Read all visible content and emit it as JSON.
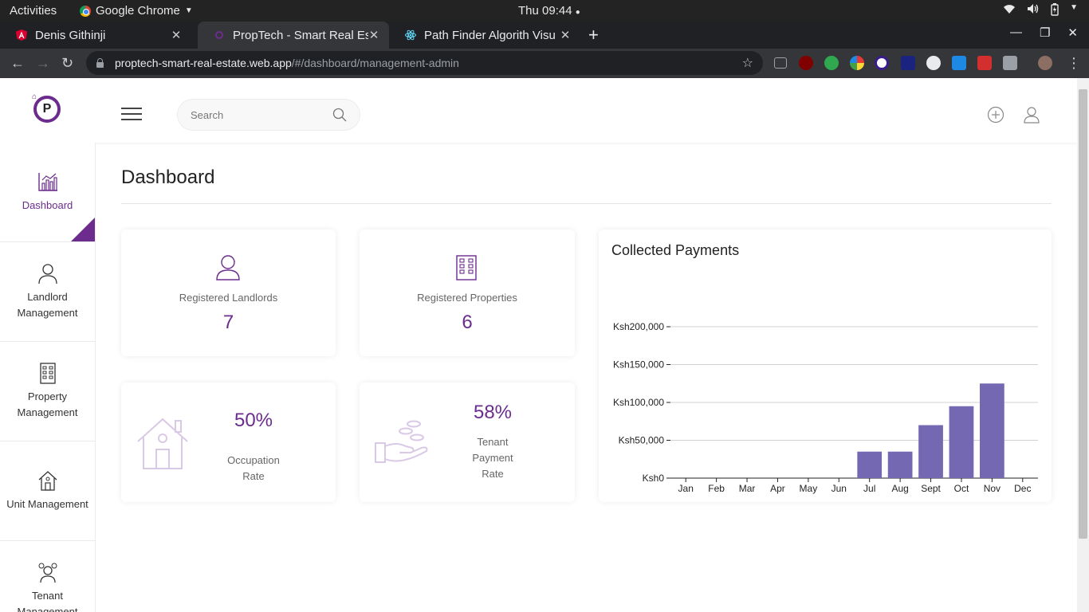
{
  "os": {
    "activities": "Activities",
    "app_name": "Google Chrome",
    "clock": "Thu 09:44"
  },
  "browser": {
    "tabs": [
      {
        "title": "Denis Githinji",
        "icon": "angular-icon",
        "active": false
      },
      {
        "title": "PropTech - Smart Real Est",
        "icon": "proptech-favicon",
        "active": true
      },
      {
        "title": "Path Finder Algorith Visu",
        "icon": "react-icon",
        "active": false
      }
    ],
    "url_host": "proptech-smart-real-estate.web.app",
    "url_path": "/#/dashboard/management-admin"
  },
  "header": {
    "logo_letter": "P",
    "search_placeholder": "Search"
  },
  "sidebar": {
    "items": [
      {
        "label": "Dashboard",
        "icon": "chart-icon",
        "active": true
      },
      {
        "label": "Landlord\nManagement",
        "icon": "person-icon",
        "active": false
      },
      {
        "label": "Property\nManagement",
        "icon": "building-icon",
        "active": false
      },
      {
        "label": "Unit Management",
        "icon": "house-icon",
        "active": false
      },
      {
        "label": "Tenant\nManagement",
        "icon": "people-icon",
        "active": false
      }
    ]
  },
  "main": {
    "title": "Dashboard",
    "stats": {
      "landlords": {
        "label": "Registered Landlords",
        "value": "7"
      },
      "properties": {
        "label": "Registered Properties",
        "value": "6"
      },
      "occupation": {
        "value": "50%",
        "label": "Occupation\nRate"
      },
      "payment": {
        "value": "58%",
        "label": "Tenant\nPayment\nRate"
      }
    }
  },
  "colors": {
    "brand": "#6b2c8e",
    "bar": "#7468b2",
    "icon_light": "#d9c9e6"
  },
  "chart_data": {
    "type": "bar",
    "title": "Collected Payments",
    "categories": [
      "Jan",
      "Feb",
      "Mar",
      "Apr",
      "May",
      "Jun",
      "Jul",
      "Aug",
      "Sept",
      "Oct",
      "Nov",
      "Dec"
    ],
    "values": [
      0,
      0,
      0,
      0,
      0,
      0,
      35000,
      35000,
      70000,
      95000,
      125000,
      0
    ],
    "y_ticks": [
      0,
      50000,
      100000,
      150000,
      200000
    ],
    "y_tick_labels": [
      "Ksh0",
      "Ksh50,000",
      "Ksh100,000",
      "Ksh150,000",
      "Ksh200,000"
    ],
    "ylim": [
      0,
      200000
    ],
    "grid": true
  }
}
